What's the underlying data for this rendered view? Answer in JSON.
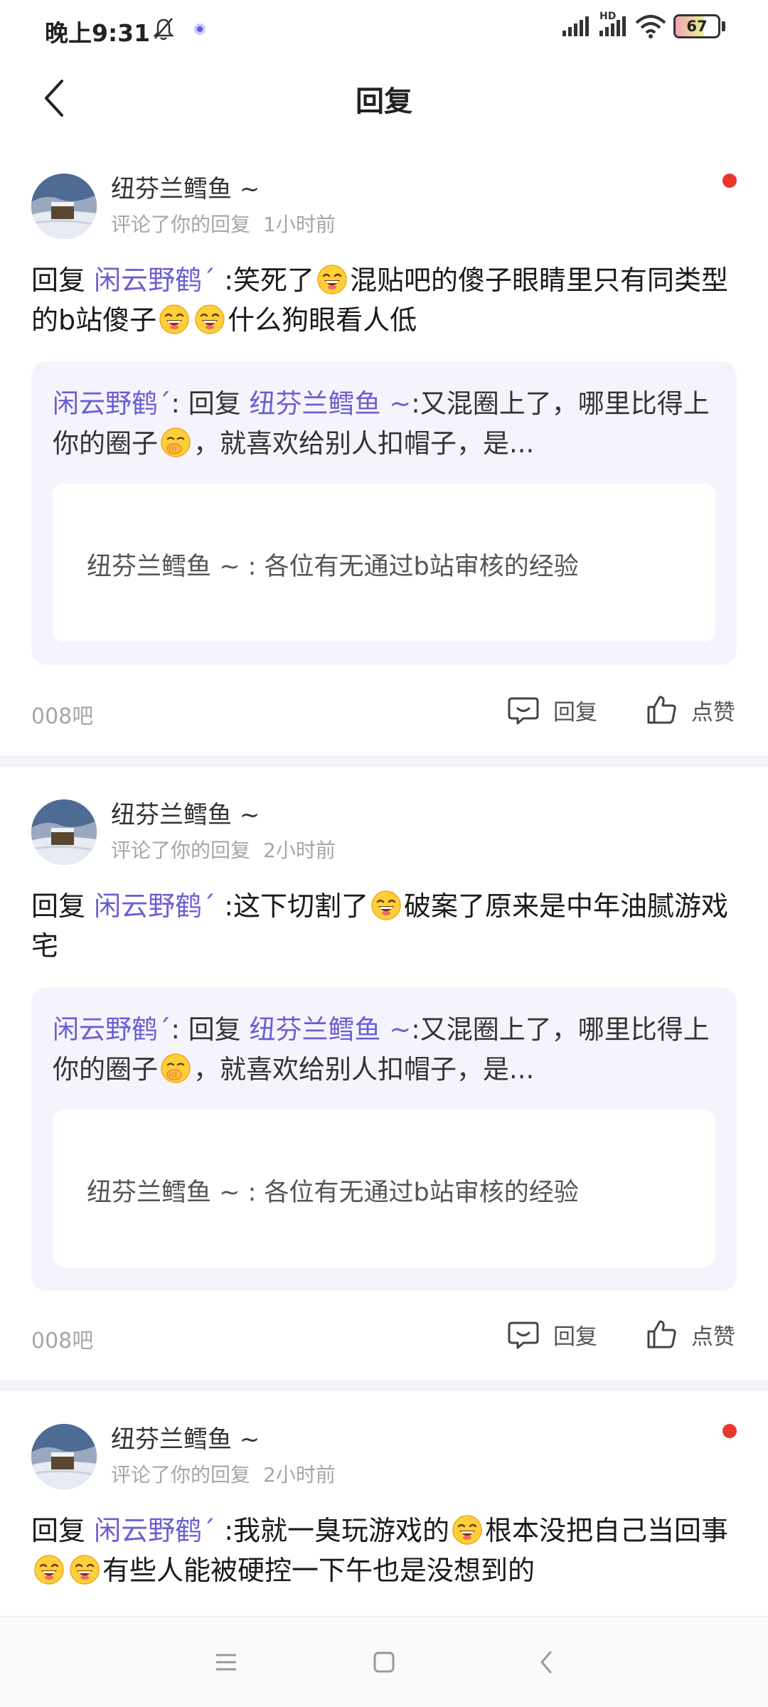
{
  "status_bar": {
    "time": "晚上9:31",
    "battery": "67",
    "network": "HD"
  },
  "header": {
    "title": "回复"
  },
  "comments": [
    {
      "username": "纽芬兰鳕鱼 ~",
      "action": "评论了你的回复",
      "time": "1小时前",
      "unread": true,
      "reply_prefix": "回复",
      "reply_target": "闲云野鹤ˊ",
      "reply_segments": [
        ":笑死了",
        "混贴吧的傻子眼睛里只有同类型的b站傻子",
        "",
        "什么狗眼看人低"
      ],
      "quote_author": "闲云野鹤ˊ",
      "quote_reply_label": ": 回复",
      "quote_target": "纽芬兰鳕鱼 ~",
      "quote_part1": ":又混圈上了，哪里比得上你的圈子",
      "quote_part2": "，就喜欢给别人扣帽子，是...",
      "inner_quote": "纽芬兰鳕鱼 ~ : 各位有无通过b站审核的经验",
      "bar": "008吧",
      "reply_label": "回复",
      "like_label": "点赞"
    },
    {
      "username": "纽芬兰鳕鱼 ~",
      "action": "评论了你的回复",
      "time": "2小时前",
      "unread": false,
      "reply_prefix": "回复",
      "reply_target": "闲云野鹤ˊ",
      "reply_segments": [
        ":这下切割了",
        "破案了原来是中年油腻游戏宅"
      ],
      "quote_author": "闲云野鹤ˊ",
      "quote_reply_label": ": 回复",
      "quote_target": "纽芬兰鳕鱼 ~",
      "quote_part1": ":又混圈上了，哪里比得上你的圈子",
      "quote_part2": "，就喜欢给别人扣帽子，是...",
      "inner_quote": "纽芬兰鳕鱼 ~ : 各位有无通过b站审核的经验",
      "bar": "008吧",
      "reply_label": "回复",
      "like_label": "点赞"
    },
    {
      "username": "纽芬兰鳕鱼 ~",
      "action": "评论了你的回复",
      "time": "2小时前",
      "unread": true,
      "reply_prefix": "回复",
      "reply_target": "闲云野鹤ˊ",
      "reply_segments": [
        ":我就一臭玩游戏的",
        "根本没把自己当回事",
        "",
        "有些人能被硬控一下午也是没想到的"
      ]
    }
  ],
  "icons": {
    "back": "back-arrow-icon",
    "emoji": "grin-emoji-icon",
    "shush": "shush-emoji-icon",
    "comment": "comment-bubble-icon",
    "like": "thumb-up-icon"
  },
  "colors": {
    "link": "#6b5fd1",
    "unread": "#e8372f",
    "quote_bg": "#f5f4fd"
  }
}
